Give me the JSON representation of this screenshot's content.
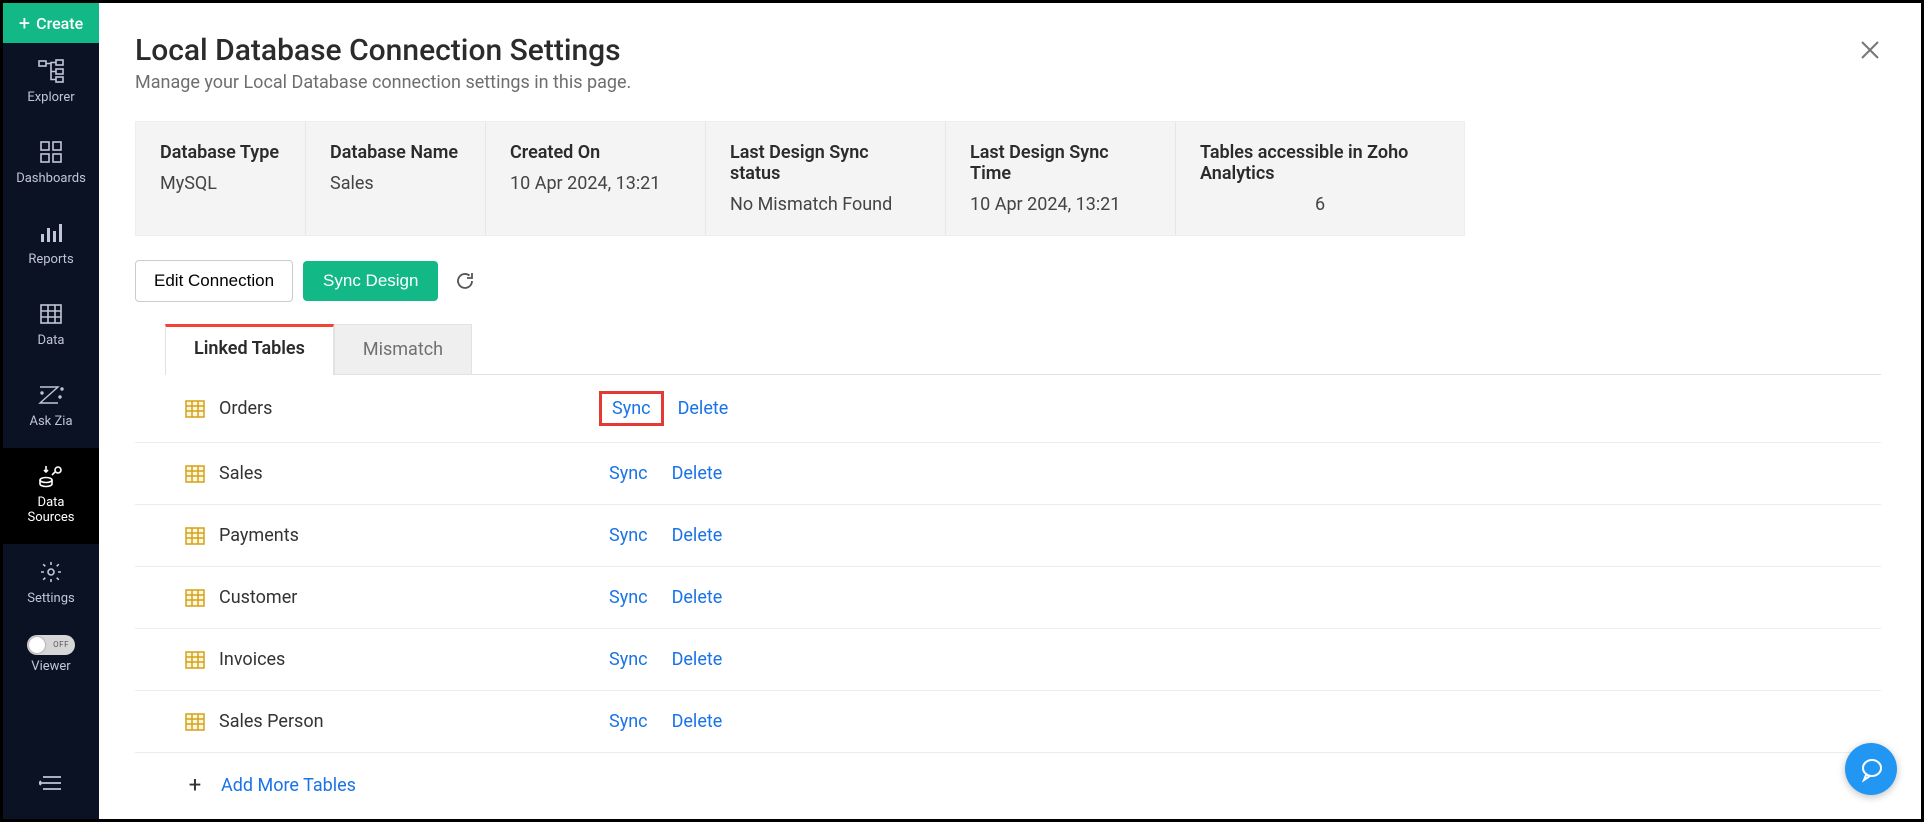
{
  "sidebar": {
    "create_label": "Create",
    "items": [
      {
        "label": "Explorer"
      },
      {
        "label": "Dashboards"
      },
      {
        "label": "Reports"
      },
      {
        "label": "Data"
      },
      {
        "label": "Ask Zia"
      },
      {
        "label": "Data\nSources"
      },
      {
        "label": "Settings"
      }
    ],
    "toggle_label": "OFF",
    "viewer_label": "Viewer"
  },
  "page": {
    "title": "Local Database Connection Settings",
    "subtitle": "Manage your Local Database connection settings in this page."
  },
  "info": {
    "db_type_hdr": "Database Type",
    "db_type_val": "MySQL",
    "db_name_hdr": "Database Name",
    "db_name_val": "Sales",
    "created_hdr": "Created On",
    "created_val": "10 Apr 2024, 13:21",
    "sync_status_hdr": "Last Design Sync status",
    "sync_status_val": "No Mismatch Found",
    "sync_time_hdr": "Last Design Sync Time",
    "sync_time_val": "10 Apr 2024, 13:21",
    "tables_hdr": "Tables accessible in Zoho Analytics",
    "tables_val": "6"
  },
  "buttons": {
    "edit_connection": "Edit Connection",
    "sync_design": "Sync Design"
  },
  "tabs": {
    "linked": "Linked Tables",
    "mismatch": "Mismatch"
  },
  "linked_tables": [
    {
      "name": "Orders",
      "sync": "Sync",
      "delete": "Delete",
      "highlight": true
    },
    {
      "name": "Sales",
      "sync": "Sync",
      "delete": "Delete",
      "highlight": false
    },
    {
      "name": "Payments",
      "sync": "Sync",
      "delete": "Delete",
      "highlight": false
    },
    {
      "name": "Customer",
      "sync": "Sync",
      "delete": "Delete",
      "highlight": false
    },
    {
      "name": "Invoices",
      "sync": "Sync",
      "delete": "Delete",
      "highlight": false
    },
    {
      "name": "Sales Person",
      "sync": "Sync",
      "delete": "Delete",
      "highlight": false
    }
  ],
  "add_more_label": "Add More Tables"
}
